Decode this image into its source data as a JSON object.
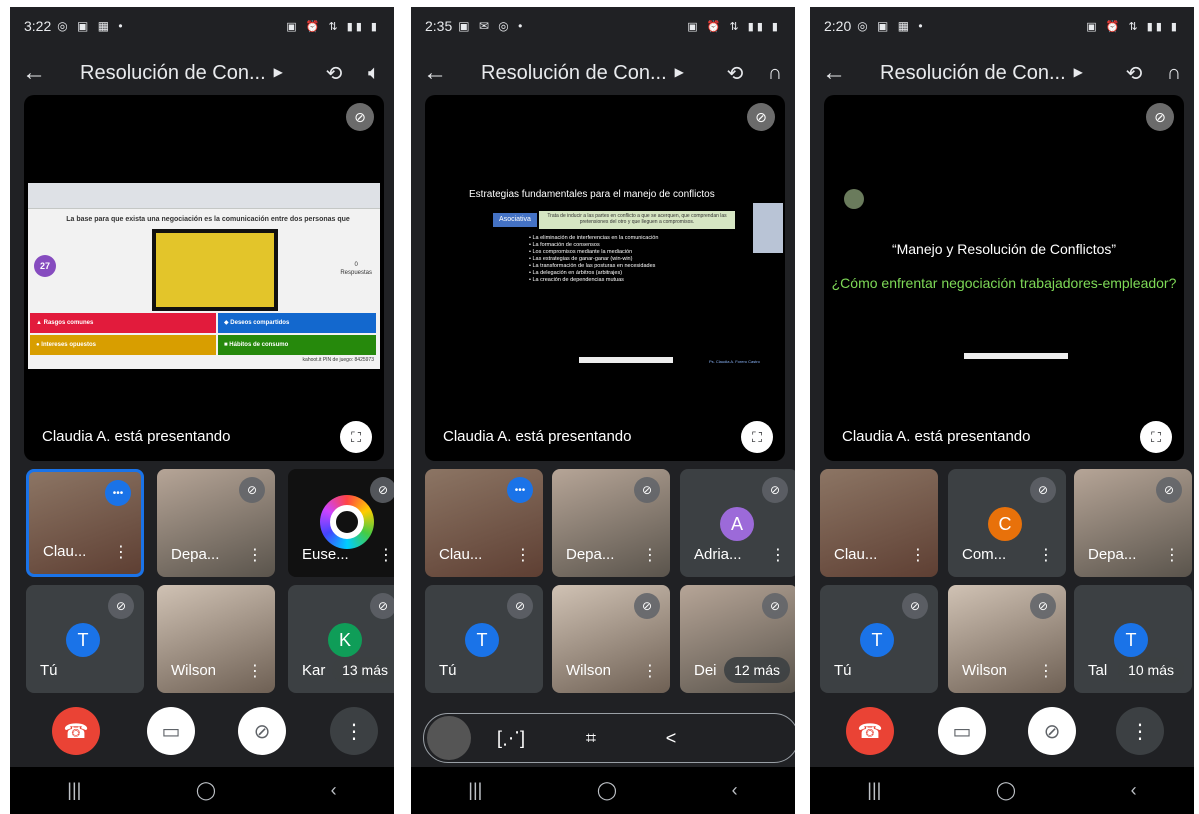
{
  "phones": [
    {
      "status": {
        "time": "3:22"
      },
      "title": "Resolución de Con...",
      "presenting": "Claudia A. está presentando",
      "kahoot": {
        "question": "La base para que exista una negociación es la comunicación entre dos personas que tienen...",
        "count": "27",
        "responses_num": "0",
        "responses_label": "Respuestas",
        "answers": [
          "Rasgos comunes",
          "Deseos compartidos",
          "Intereses opuestos",
          "Hábitos de consumo"
        ],
        "pin": "kahoot.it PIN de juego: 8425973"
      },
      "tiles": [
        {
          "name": "Clau..."
        },
        {
          "name": "Depa..."
        },
        {
          "name": "Euse..."
        },
        {
          "name": "Tú",
          "initial": "T"
        },
        {
          "name": "Wilson"
        },
        {
          "name": "Kar",
          "initial": "K",
          "more": "13 más"
        }
      ]
    },
    {
      "status": {
        "time": "2:35"
      },
      "title": "Resolución de Con...",
      "presenting": "Claudia A. está presentando",
      "slide": {
        "title": "Estrategias fundamentales para el manejo de conflictos",
        "tag": "Asociativa",
        "tag_desc": "Trata de inducir a las partes en conflicto a que se acerquen, que comprendan las pretensiones del otro y que lleguen a compromisos.",
        "bullets": [
          "La eliminación de interferencias en la comunicación",
          "La formación de consensos",
          "Los compromisos mediante la mediación",
          "Las estrategias de ganar-ganar (win-win)",
          "La transformación de las posturas en necesidades",
          "La delegación en árbitros (arbitrajes)",
          "La creación de dependencias mutuas"
        ],
        "author": "Ps. Claudia A. Forero Castro"
      },
      "tiles": [
        {
          "name": "Clau..."
        },
        {
          "name": "Depa..."
        },
        {
          "name": "Adria...",
          "initial": "A"
        },
        {
          "name": "Tú",
          "initial": "T"
        },
        {
          "name": "Wilson"
        },
        {
          "name": "Dei",
          "more": "12 más"
        }
      ]
    },
    {
      "status": {
        "time": "2:20"
      },
      "title": "Resolución de Con...",
      "presenting": "Claudia A. está presentando",
      "slide": {
        "title": "“Manejo y Resolución de Conflictos”",
        "subtitle": "¿Cómo enfrentar negociación trabajadores-empleador?"
      },
      "tiles": [
        {
          "name": "Clau..."
        },
        {
          "name": "Com...",
          "initial": "C"
        },
        {
          "name": "Depa..."
        },
        {
          "name": "Tú",
          "initial": "T"
        },
        {
          "name": "Wilson"
        },
        {
          "name": "Tal",
          "initial": "T",
          "more": "10 más"
        }
      ]
    }
  ],
  "colors": {
    "background": "#202124",
    "end_call": "#ea4335",
    "accent": "#1a73e8",
    "avatar_blue": "#1a73e8",
    "avatar_green": "#0f9d58",
    "avatar_purple": "#9c6ad9",
    "avatar_orange": "#e8710a"
  }
}
